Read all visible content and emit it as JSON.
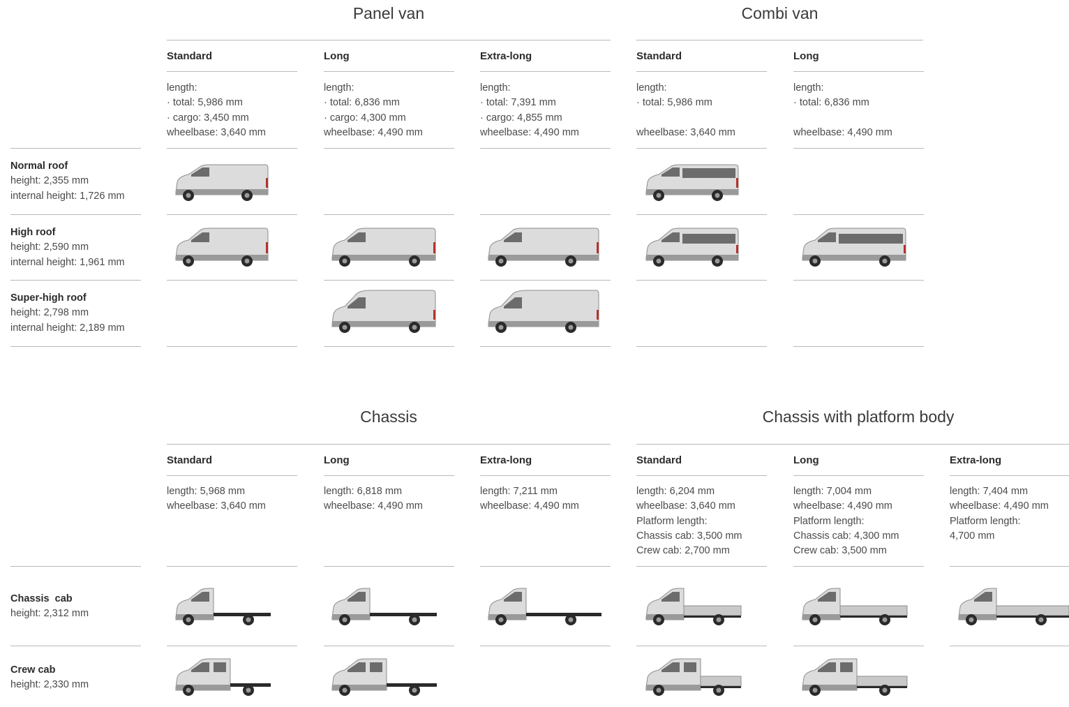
{
  "section1": {
    "groups": [
      {
        "title": "Panel van"
      },
      {
        "title": "Combi van"
      }
    ],
    "columns": [
      {
        "label": "Standard",
        "specs": [
          "length:",
          "· total: 5,986 mm",
          "· cargo: 3,450 mm",
          "wheelbase: 3,640 mm"
        ]
      },
      {
        "label": "Long",
        "specs": [
          "length:",
          "· total: 6,836 mm",
          "· cargo: 4,300 mm",
          "wheelbase: 4,490 mm"
        ]
      },
      {
        "label": "Extra-long",
        "specs": [
          "length:",
          "· total: 7,391 mm",
          "· cargo: 4,855 mm",
          "wheelbase: 4,490 mm"
        ]
      },
      {
        "label": "Standard",
        "specs": [
          "length:",
          "· total: 5,986 mm",
          "",
          "wheelbase: 3,640 mm"
        ]
      },
      {
        "label": "Long",
        "specs": [
          "length:",
          "· total: 6,836 mm",
          "",
          "wheelbase: 4,490 mm"
        ]
      }
    ],
    "rows": [
      {
        "title": "Normal roof",
        "lines": [
          "height: 2,355 mm",
          "internal height: 1,726 mm"
        ]
      },
      {
        "title": "High roof",
        "lines": [
          "height: 2,590 mm",
          "internal height: 1,961 mm"
        ]
      },
      {
        "title": "Super-high roof",
        "lines": [
          "height: 2,798 mm",
          "internal height: 2,189 mm"
        ]
      }
    ]
  },
  "section2": {
    "groups": [
      {
        "title": "Chassis"
      },
      {
        "title": "Chassis with platform body"
      }
    ],
    "columns": [
      {
        "label": "Standard",
        "specs": [
          "length: 5,968 mm",
          "wheelbase: 3,640 mm"
        ]
      },
      {
        "label": "Long",
        "specs": [
          "length: 6,818 mm",
          "wheelbase: 4,490 mm"
        ]
      },
      {
        "label": "Extra-long",
        "specs": [
          "length: 7,211 mm",
          "wheelbase: 4,490 mm"
        ]
      },
      {
        "label": "Standard",
        "specs": [
          "length: 6,204 mm",
          "wheelbase: 3,640 mm",
          "Platform length:",
          "Chassis cab: 3,500 mm",
          "Crew cab: 2,700 mm"
        ]
      },
      {
        "label": "Long",
        "specs": [
          "length: 7,004 mm",
          "wheelbase: 4,490 mm",
          "Platform length:",
          "Chassis cab: 4,300 mm",
          "Crew cab: 3,500 mm"
        ]
      },
      {
        "label": "Extra-long",
        "specs": [
          "length: 7,404 mm",
          "wheelbase: 4,490 mm",
          "Platform length:",
          "4,700 mm"
        ]
      }
    ],
    "rows": [
      {
        "title": "Chassis  cab",
        "lines": [
          "height: 2,312 mm"
        ]
      },
      {
        "title": "Crew cab",
        "lines": [
          "height: 2,330 mm"
        ]
      }
    ]
  },
  "colors": {
    "body": "#d9d9d9",
    "body_shade": "#9a9a9a",
    "window": "#6c6c6c",
    "tire": "#2a2a2a",
    "rule": "#b9b9b9",
    "taillight": "#b5322c"
  },
  "icons": {
    "panel_van": "panel-van-icon",
    "combi_van": "combi-van-icon",
    "chassis_cab": "chassis-cab-icon",
    "crew_cab_chassis": "crew-cab-chassis-icon",
    "platform_body": "platform-body-icon"
  }
}
